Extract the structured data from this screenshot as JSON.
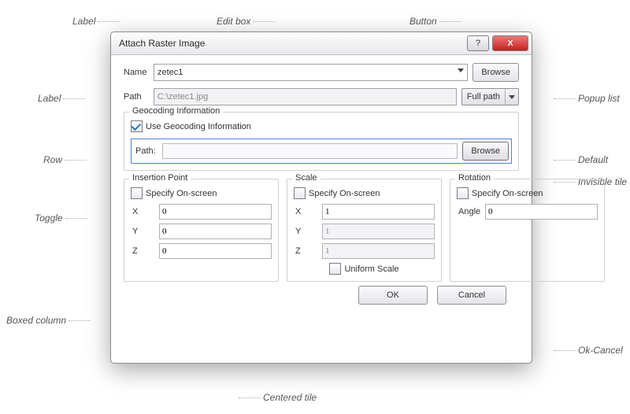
{
  "callouts": {
    "label_top": "Label",
    "editbox": "Edit box",
    "button": "Button",
    "label_left": "Label",
    "popup_list": "Popup list",
    "row": "Row",
    "default": "Default",
    "toggle": "Toggle",
    "invisible_tile": "Invisible tile",
    "boxed_column": "Boxed column",
    "ok_cancel": "Ok-Cancel",
    "centered_tile": "Centered tile"
  },
  "window": {
    "title": "Attach Raster Image",
    "help_glyph": "?",
    "close_glyph": "X"
  },
  "name_row": {
    "label": "Name",
    "value": "zetec1",
    "browse": "Browse"
  },
  "path_row": {
    "label": "Path",
    "value": "C:\\zetec1.jpg",
    "fullpath": "Full path"
  },
  "geocoding": {
    "legend": "Geocoding Information",
    "use_label": "Use Geocoding Information",
    "path_label": "Path:",
    "path_value": "",
    "browse": "Browse"
  },
  "insertion": {
    "legend": "Insertion Point",
    "specify": "Specify On-screen",
    "x_label": "X",
    "x": "0",
    "y_label": "Y",
    "y": "0",
    "z_label": "Z",
    "z": "0"
  },
  "scale": {
    "legend": "Scale",
    "specify": "Specify On-screen",
    "x_label": "X",
    "x": "1",
    "y_label": "Y",
    "y": "1",
    "z_label": "Z",
    "z": "1",
    "uniform": "Uniform Scale"
  },
  "rotation": {
    "legend": "Rotation",
    "specify": "Specify On-screen",
    "angle_label": "Angle",
    "angle": "0"
  },
  "footer": {
    "ok": "OK",
    "cancel": "Cancel"
  }
}
